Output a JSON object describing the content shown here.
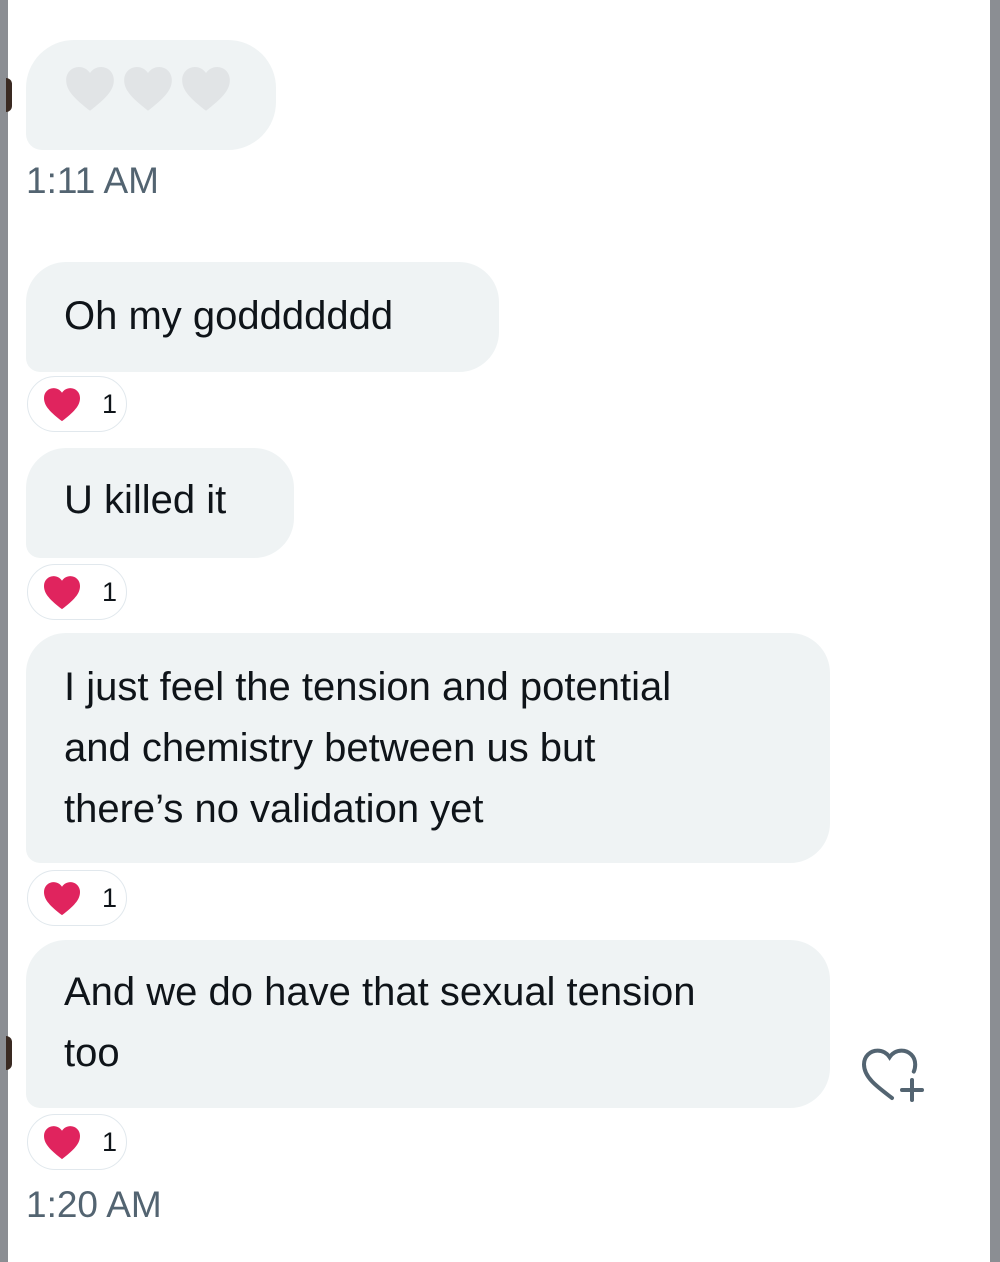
{
  "conversation": {
    "emoji_message": {
      "content": "heart emojis",
      "emoji_icon": "heart-emoji-icon"
    },
    "timestamps": [
      "1:11 AM",
      "1:20 AM"
    ],
    "messages": [
      {
        "text": "Oh my goddddddd",
        "reaction": {
          "icon": "red-heart-icon",
          "count": "1"
        }
      },
      {
        "text": "U killed it",
        "reaction": {
          "icon": "red-heart-icon",
          "count": "1"
        }
      },
      {
        "text": "I just feel the tension and potential\nand chemistry between us but\nthere’s no validation yet",
        "reaction": {
          "icon": "red-heart-icon",
          "count": "1"
        }
      },
      {
        "text": "And we do have that sexual tension\ntoo",
        "reaction": {
          "icon": "red-heart-icon",
          "count": "1"
        }
      }
    ],
    "add_reaction_icon": "heart-plus-icon",
    "colors": {
      "bubble_bg": "#eff3f4",
      "heart_red": "#e0245e",
      "timestamp_text": "#536471",
      "message_text": "#0f1419"
    }
  }
}
